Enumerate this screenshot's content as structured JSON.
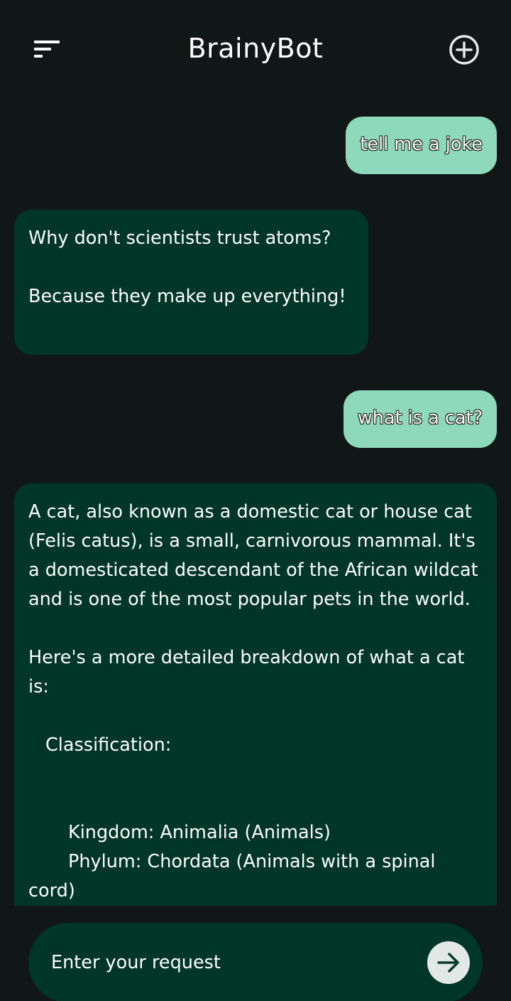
{
  "header": {
    "title": "BrainyBot",
    "menu_icon": "sort-lines-icon",
    "new_chat_icon": "plus-circle-icon"
  },
  "messages": [
    {
      "role": "user",
      "text": "tell me a joke"
    },
    {
      "role": "bot",
      "lines": [
        "Why don't scientists trust atoms?",
        "",
        "Because they make up everything!"
      ]
    },
    {
      "role": "user",
      "text": "what is a cat?"
    },
    {
      "role": "bot",
      "paragraph1": "A cat, also known as a domestic cat or house cat (Felis catus), is a small, carnivorous mammal. It's a domesticated descendant of the African wildcat and is one of the most popular pets in the world.",
      "paragraph2": "Here's a more detailed breakdown of what a cat is:",
      "section": "Classification:",
      "items": [
        "Kingdom: Animalia (Animals)",
        "Phylum: Chordata (Animals with a spinal cord)"
      ]
    }
  ],
  "input": {
    "placeholder": "Enter your request",
    "send_icon": "arrow-right-icon"
  },
  "colors": {
    "background": "#111716",
    "user_bubble": "#8ed8bb",
    "bot_bubble": "#003628",
    "send_button": "#e2e8e5"
  }
}
